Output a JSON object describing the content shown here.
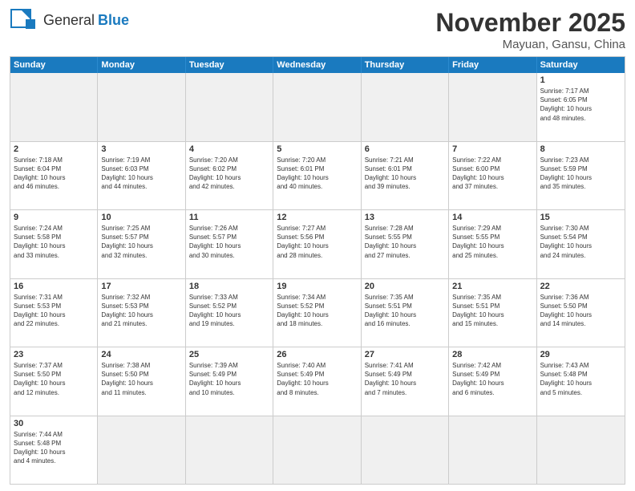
{
  "header": {
    "logo": {
      "text_general": "General",
      "text_blue": "Blue"
    },
    "title": "November 2025",
    "location": "Mayuan, Gansu, China"
  },
  "weekdays": [
    "Sunday",
    "Monday",
    "Tuesday",
    "Wednesday",
    "Thursday",
    "Friday",
    "Saturday"
  ],
  "weeks": [
    [
      {
        "day": "",
        "info": ""
      },
      {
        "day": "",
        "info": ""
      },
      {
        "day": "",
        "info": ""
      },
      {
        "day": "",
        "info": ""
      },
      {
        "day": "",
        "info": ""
      },
      {
        "day": "",
        "info": ""
      },
      {
        "day": "1",
        "info": "Sunrise: 7:17 AM\nSunset: 6:05 PM\nDaylight: 10 hours\nand 48 minutes."
      }
    ],
    [
      {
        "day": "2",
        "info": "Sunrise: 7:18 AM\nSunset: 6:04 PM\nDaylight: 10 hours\nand 46 minutes."
      },
      {
        "day": "3",
        "info": "Sunrise: 7:19 AM\nSunset: 6:03 PM\nDaylight: 10 hours\nand 44 minutes."
      },
      {
        "day": "4",
        "info": "Sunrise: 7:20 AM\nSunset: 6:02 PM\nDaylight: 10 hours\nand 42 minutes."
      },
      {
        "day": "5",
        "info": "Sunrise: 7:20 AM\nSunset: 6:01 PM\nDaylight: 10 hours\nand 40 minutes."
      },
      {
        "day": "6",
        "info": "Sunrise: 7:21 AM\nSunset: 6:01 PM\nDaylight: 10 hours\nand 39 minutes."
      },
      {
        "day": "7",
        "info": "Sunrise: 7:22 AM\nSunset: 6:00 PM\nDaylight: 10 hours\nand 37 minutes."
      },
      {
        "day": "8",
        "info": "Sunrise: 7:23 AM\nSunset: 5:59 PM\nDaylight: 10 hours\nand 35 minutes."
      }
    ],
    [
      {
        "day": "9",
        "info": "Sunrise: 7:24 AM\nSunset: 5:58 PM\nDaylight: 10 hours\nand 33 minutes."
      },
      {
        "day": "10",
        "info": "Sunrise: 7:25 AM\nSunset: 5:57 PM\nDaylight: 10 hours\nand 32 minutes."
      },
      {
        "day": "11",
        "info": "Sunrise: 7:26 AM\nSunset: 5:57 PM\nDaylight: 10 hours\nand 30 minutes."
      },
      {
        "day": "12",
        "info": "Sunrise: 7:27 AM\nSunset: 5:56 PM\nDaylight: 10 hours\nand 28 minutes."
      },
      {
        "day": "13",
        "info": "Sunrise: 7:28 AM\nSunset: 5:55 PM\nDaylight: 10 hours\nand 27 minutes."
      },
      {
        "day": "14",
        "info": "Sunrise: 7:29 AM\nSunset: 5:55 PM\nDaylight: 10 hours\nand 25 minutes."
      },
      {
        "day": "15",
        "info": "Sunrise: 7:30 AM\nSunset: 5:54 PM\nDaylight: 10 hours\nand 24 minutes."
      }
    ],
    [
      {
        "day": "16",
        "info": "Sunrise: 7:31 AM\nSunset: 5:53 PM\nDaylight: 10 hours\nand 22 minutes."
      },
      {
        "day": "17",
        "info": "Sunrise: 7:32 AM\nSunset: 5:53 PM\nDaylight: 10 hours\nand 21 minutes."
      },
      {
        "day": "18",
        "info": "Sunrise: 7:33 AM\nSunset: 5:52 PM\nDaylight: 10 hours\nand 19 minutes."
      },
      {
        "day": "19",
        "info": "Sunrise: 7:34 AM\nSunset: 5:52 PM\nDaylight: 10 hours\nand 18 minutes."
      },
      {
        "day": "20",
        "info": "Sunrise: 7:35 AM\nSunset: 5:51 PM\nDaylight: 10 hours\nand 16 minutes."
      },
      {
        "day": "21",
        "info": "Sunrise: 7:35 AM\nSunset: 5:51 PM\nDaylight: 10 hours\nand 15 minutes."
      },
      {
        "day": "22",
        "info": "Sunrise: 7:36 AM\nSunset: 5:50 PM\nDaylight: 10 hours\nand 14 minutes."
      }
    ],
    [
      {
        "day": "23",
        "info": "Sunrise: 7:37 AM\nSunset: 5:50 PM\nDaylight: 10 hours\nand 12 minutes."
      },
      {
        "day": "24",
        "info": "Sunrise: 7:38 AM\nSunset: 5:50 PM\nDaylight: 10 hours\nand 11 minutes."
      },
      {
        "day": "25",
        "info": "Sunrise: 7:39 AM\nSunset: 5:49 PM\nDaylight: 10 hours\nand 10 minutes."
      },
      {
        "day": "26",
        "info": "Sunrise: 7:40 AM\nSunset: 5:49 PM\nDaylight: 10 hours\nand 8 minutes."
      },
      {
        "day": "27",
        "info": "Sunrise: 7:41 AM\nSunset: 5:49 PM\nDaylight: 10 hours\nand 7 minutes."
      },
      {
        "day": "28",
        "info": "Sunrise: 7:42 AM\nSunset: 5:49 PM\nDaylight: 10 hours\nand 6 minutes."
      },
      {
        "day": "29",
        "info": "Sunrise: 7:43 AM\nSunset: 5:48 PM\nDaylight: 10 hours\nand 5 minutes."
      }
    ],
    [
      {
        "day": "30",
        "info": "Sunrise: 7:44 AM\nSunset: 5:48 PM\nDaylight: 10 hours\nand 4 minutes."
      },
      {
        "day": "",
        "info": ""
      },
      {
        "day": "",
        "info": ""
      },
      {
        "day": "",
        "info": ""
      },
      {
        "day": "",
        "info": ""
      },
      {
        "day": "",
        "info": ""
      },
      {
        "day": "",
        "info": ""
      }
    ]
  ]
}
